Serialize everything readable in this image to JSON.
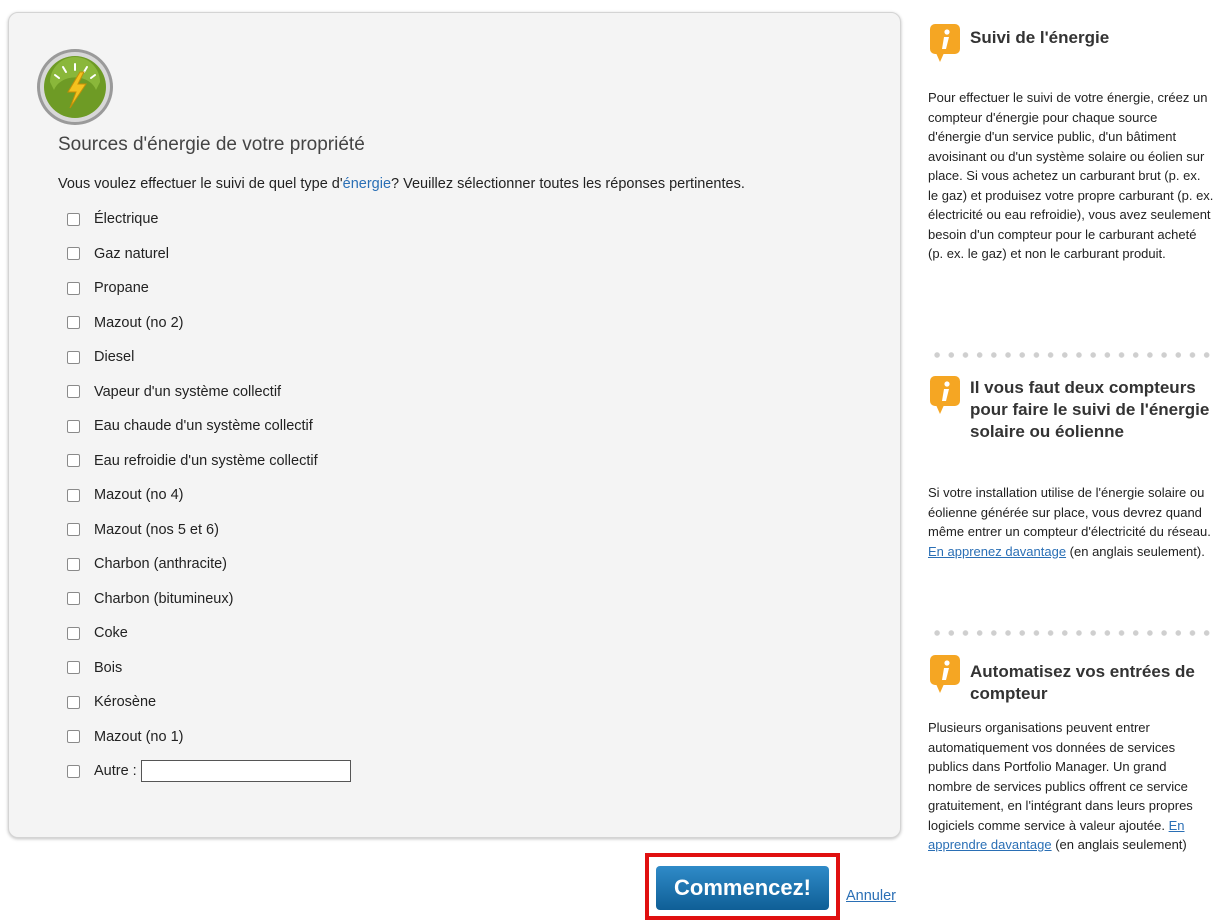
{
  "panel": {
    "title": "Sources d'énergie de votre propriété",
    "question_prefix": "Vous voulez effectuer le suivi de quel type d'",
    "question_link": "énergie",
    "question_suffix": "? Veuillez sélectionner toutes les réponses pertinentes.",
    "options": [
      "Électrique",
      "Gaz naturel",
      "Propane",
      "Mazout (no 2)",
      "Diesel",
      "Vapeur d'un système collectif",
      "Eau chaude d'un système collectif",
      "Eau refroidie d'un système collectif",
      "Mazout (no 4)",
      "Mazout (nos 5 et 6)",
      "Charbon (anthracite)",
      "Charbon (bitumineux)",
      "Coke",
      "Bois",
      "Kérosène",
      "Mazout (no 1)"
    ],
    "other_label": "Autre :",
    "other_value": ""
  },
  "actions": {
    "start_label": "Commencez!",
    "cancel_label": "Annuler"
  },
  "sidebar": {
    "section1": {
      "title": "Suivi de l'énergie",
      "text": "Pour effectuer le suivi de votre énergie, créez un compteur d'énergie pour chaque source d'énergie d'un service public, d'un bâtiment avoisinant ou d'un système solaire ou éolien sur place. Si vous achetez un carburant brut (p. ex. le gaz) et produisez votre propre carburant (p. ex. électricité ou eau refroidie), vous avez seulement besoin d'un compteur pour le carburant acheté (p. ex. le gaz) et non le carburant produit."
    },
    "section2": {
      "title": "Il vous faut deux compteurs pour faire le suivi de l'énergie solaire ou éolienne",
      "text": "Si votre installation utilise de l'énergie solaire ou éolienne générée sur place, vous devrez quand même entrer un compteur d'électricité du réseau. ",
      "link": "En apprenez davantage",
      "suffix": " (en anglais seulement)."
    },
    "section3": {
      "title": "Automatisez vos entrées de compteur",
      "text": "Plusieurs organisations peuvent entrer automatiquement vos données de services publics dans Portfolio Manager. Un grand nombre de services publics offrent ce service gratuitement, en l'intégrant dans leurs propres logiciels comme service à valeur ajoutée. ",
      "link": "En apprendre davantage",
      "suffix": " (en anglais seulement)"
    }
  },
  "colors": {
    "accent_blue": "#1a73b0",
    "highlight_red": "#e01010",
    "info_orange": "#f5a623",
    "badge_green": "#7cae2e"
  }
}
